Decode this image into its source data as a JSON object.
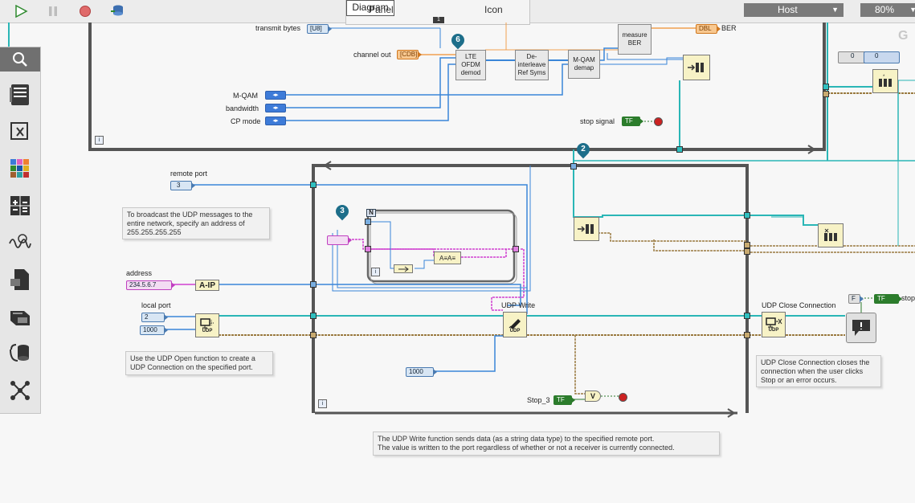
{
  "toolbar": {
    "run_icon": "run-arrow-icon",
    "pause_icon": "pause-icon",
    "abort_icon": "abort-icon",
    "debug_icon": "highlight-execution-icon",
    "tabs": [
      "Panel",
      "Diagram",
      "Icon"
    ],
    "active_tab_badge": "1",
    "target": "Host",
    "zoom": "80%"
  },
  "palette": [
    "search-icon",
    "structures-icon",
    "timing-icon",
    "data-types-icon",
    "math-icon",
    "signal-icon",
    "file-io-icon",
    "hardware-io-icon",
    "data-communication-icon",
    "connectivity-icon"
  ],
  "top_loop": {
    "transmit_bytes_label": "transmit bytes",
    "transmit_bytes_type": "[U8]",
    "channel_out_label": "channel out",
    "channel_out_type": "[CDB]",
    "mqam_label": "M-QAM",
    "bandwidth_label": "bandwidth",
    "cp_mode_label": "CP mode",
    "lte_node": "LTE OFDM demod",
    "deinterleave_node": "De-interleave Ref Syms",
    "mqam_demap_node": "M-QAM demap",
    "measure_ber_node": "measure BER",
    "ber_label": "BER",
    "ber_type": "DBL",
    "stop_signal_label": "stop signal",
    "stop_signal_type": "TF",
    "badge": "6"
  },
  "right_panel": {
    "num1": "0",
    "num2": "0",
    "stop_label": "stop",
    "stop_false": "F",
    "stop_type": "TF",
    "udp_close_label": "UDP Close Connection",
    "udp_close_comment": "UDP Close Connection closes the connection when the user clicks Stop or an error occurs."
  },
  "bottom_loop": {
    "badge_loop": "2",
    "badge_for": "3",
    "for_n": "N",
    "remote_port_label": "remote port",
    "remote_port_value": "3",
    "broadcast_comment": "To broadcast the UDP messages to the entire network, specify an address of 255.255.255.255",
    "address_label": "address",
    "address_value": "234.5.6.7",
    "string_to_ip": "A-IP",
    "local_port_label": "local port",
    "local_port_value": "2",
    "timeout_value": "1000",
    "udp_open_comment": "Use the UDP Open function to create a UDP Connection on the specified port.",
    "udp_write_label": "UDP Write",
    "udp_write_timeout": "1000",
    "stop3_label": "Stop_3",
    "stop3_type": "TF",
    "or_label": "V",
    "udp_tag": "UDP",
    "udp_write_comment_1": "The UDP Write function sends data (as a string data type) to the specified remote port.",
    "udp_write_comment_2": "The value is written to the port regardless of whether or not a receiver is currently connected."
  },
  "colors": {
    "wire_blue": "#3a86d8",
    "wire_cyan": "#2ab6b6",
    "wire_pink": "#d040d0",
    "wire_orange": "#f0a050",
    "wire_brown": "#9a7a40",
    "loop_frame": "#555555"
  }
}
